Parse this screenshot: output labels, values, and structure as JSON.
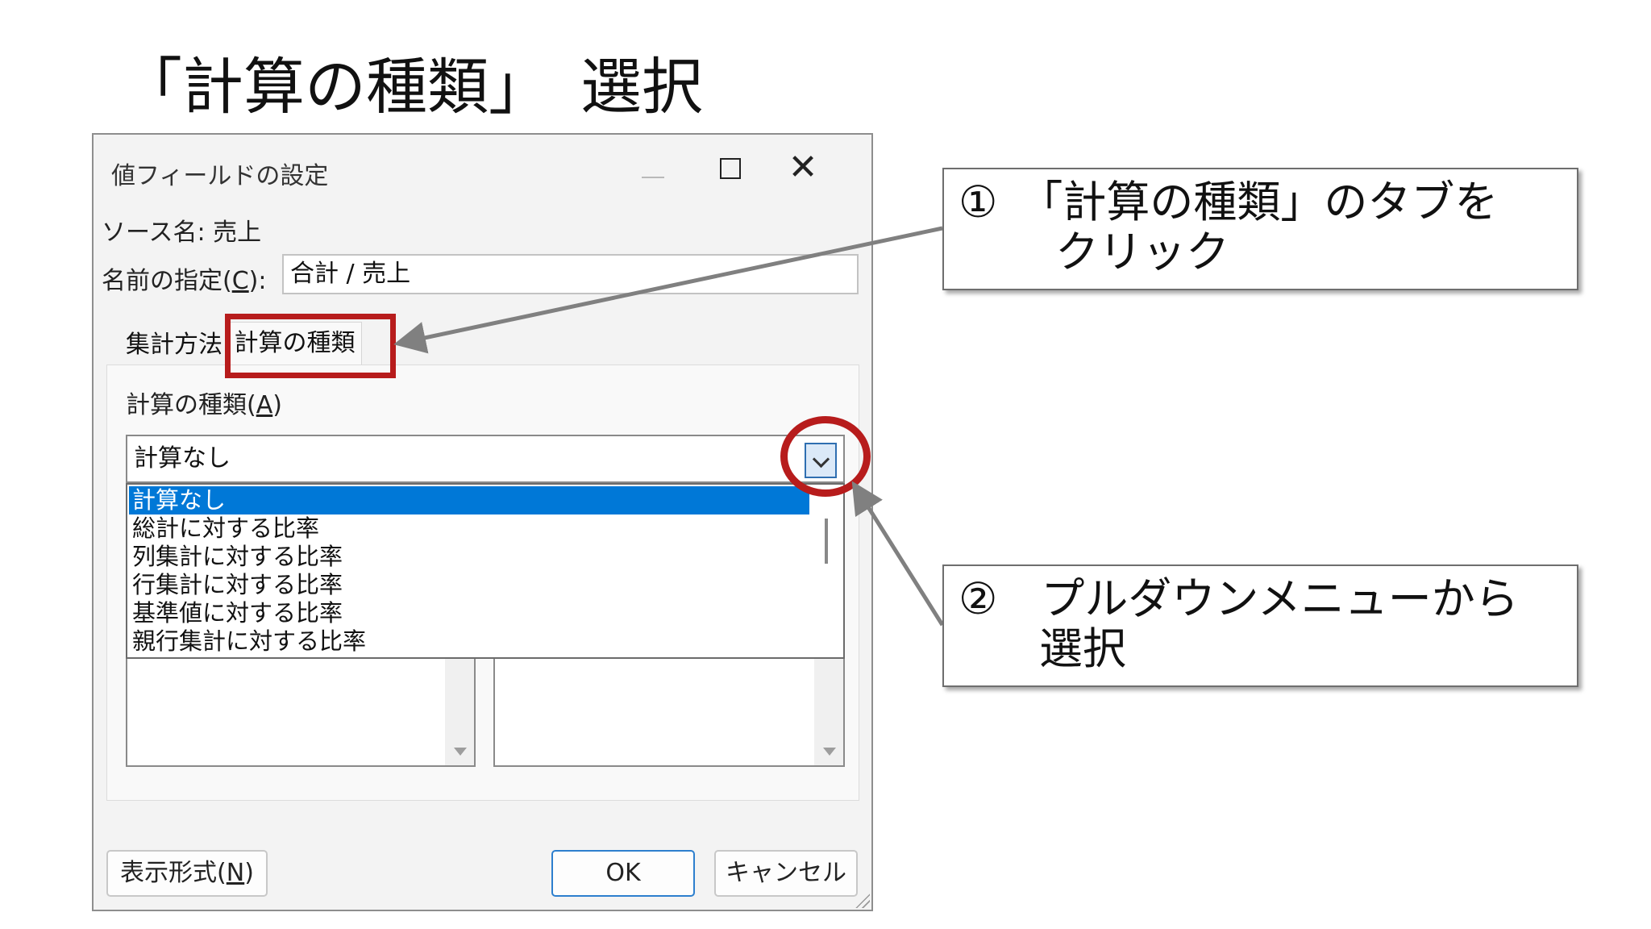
{
  "slide": {
    "title": "「計算の種類」　選択"
  },
  "dialog": {
    "title": "値フィールドの設定",
    "source_label": "ソース名:",
    "source_value": "売上",
    "name_label_prefix": "名前の指定(",
    "name_label_key": "C",
    "name_label_suffix": "):",
    "name_value": "合計 / 売上",
    "tabs": [
      {
        "label": "集計方法"
      },
      {
        "label": "計算の種類"
      }
    ],
    "calc_label_prefix": "計算の種類(",
    "calc_label_key": "A",
    "calc_label_suffix": ")",
    "calc_selected": "計算なし",
    "calc_options": [
      "計算なし",
      "総計に対する比率",
      "列集計に対する比率",
      "行集計に対する比率",
      "基準値に対する比率",
      "親行集計に対する比率"
    ],
    "format_button_prefix": "表示形式(",
    "format_button_key": "N",
    "format_button_suffix": ")",
    "ok_button": "OK",
    "cancel_button": "キャンセル"
  },
  "callouts": {
    "step1_line1": "①　「計算の種類」のタブを",
    "step1_line2": "クリック",
    "step2_line1": "②　プルダウンメニューから",
    "step2_line2": "選択"
  },
  "colors": {
    "highlight": "#b71c1c",
    "selection": "#0078d7",
    "arrow": "#808080"
  }
}
